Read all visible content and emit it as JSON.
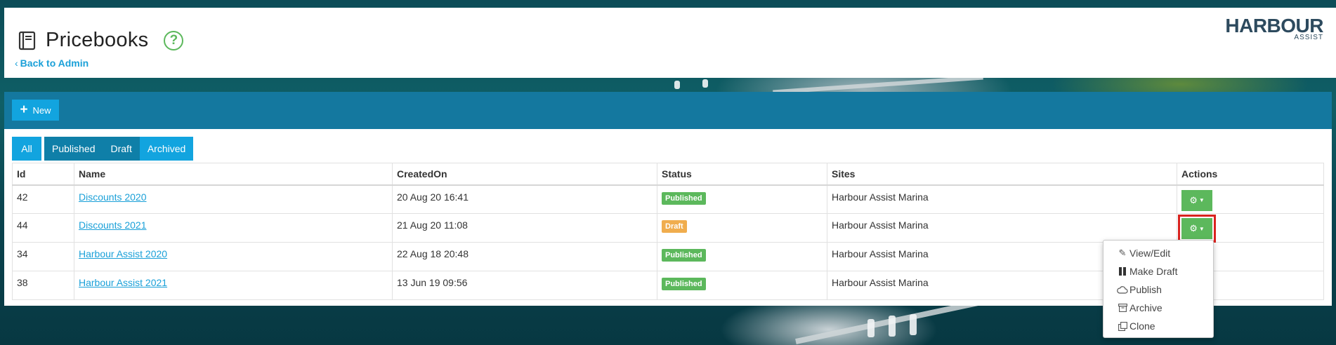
{
  "header": {
    "title": "Pricebooks",
    "back_link": "Back to Admin",
    "brand_main": "HARBOUR",
    "brand_sub": "ASSIST"
  },
  "toolbar": {
    "new_label": "New"
  },
  "tabs": [
    {
      "label": "All",
      "active": true
    },
    {
      "label": "Published",
      "active": false
    },
    {
      "label": "Draft",
      "active": false
    },
    {
      "label": "Archived",
      "active": false
    }
  ],
  "table": {
    "columns": [
      "Id",
      "Name",
      "CreatedOn",
      "Status",
      "Sites",
      "Actions"
    ],
    "rows": [
      {
        "id": "42",
        "name": "Discounts 2020",
        "created": "20 Aug 20 16:41",
        "status": "Published",
        "sites": "Harbour Assist Marina"
      },
      {
        "id": "44",
        "name": "Discounts 2021",
        "created": "21 Aug 20 11:08",
        "status": "Draft",
        "sites": "Harbour Assist Marina"
      },
      {
        "id": "34",
        "name": "Harbour Assist 2020",
        "created": "22 Aug 18 20:48",
        "status": "Published",
        "sites": "Harbour Assist Marina"
      },
      {
        "id": "38",
        "name": "Harbour Assist 2021",
        "created": "13 Jun 19 09:56",
        "status": "Published",
        "sites": "Harbour Assist Marina"
      }
    ]
  },
  "dropdown": {
    "items": [
      {
        "label": "View/Edit",
        "icon": "pencil-icon"
      },
      {
        "label": "Make Draft",
        "icon": "pause-icon"
      },
      {
        "label": "Publish",
        "icon": "cloud-icon"
      },
      {
        "label": "Archive",
        "icon": "archive-icon"
      },
      {
        "label": "Clone",
        "icon": "clone-icon"
      }
    ]
  },
  "colors": {
    "toolbar": "#14789f",
    "accent": "#12a4df",
    "published": "#5cb85c",
    "draft": "#f0ad4e",
    "highlight": "#d9231f"
  }
}
